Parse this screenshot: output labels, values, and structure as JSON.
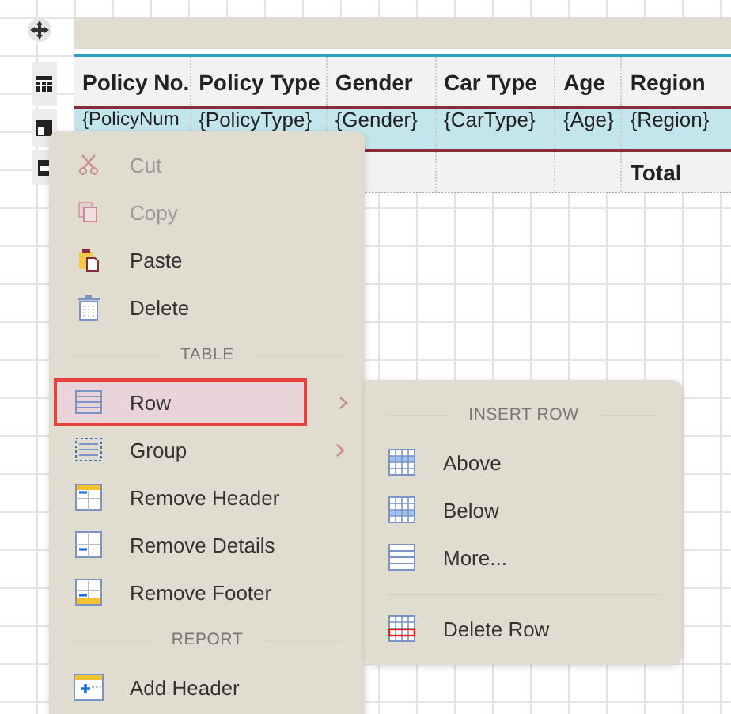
{
  "table": {
    "columns": [
      "Policy No.",
      "Policy Type",
      "Gender",
      "Car Type",
      "Age",
      "Region"
    ],
    "details_row": {
      "selected": true,
      "cells": [
        "{PolicyNum",
        "{PolicyType}",
        "{Gender}",
        "{CarType}",
        "{Age}",
        "{Region}"
      ]
    },
    "footer_total": "Total"
  },
  "context_menu": [
    {
      "kind": "item",
      "label": "Cut",
      "disabled": true
    },
    {
      "kind": "item",
      "label": "Copy",
      "disabled": true
    },
    {
      "kind": "item",
      "label": "Paste",
      "disabled": false
    },
    {
      "kind": "item",
      "label": "Delete",
      "disabled": false
    },
    {
      "kind": "section",
      "label": "TABLE"
    },
    {
      "kind": "item",
      "label": "Row",
      "disabled": false,
      "selected": true,
      "submenu": true
    },
    {
      "kind": "item",
      "label": "Group",
      "disabled": false,
      "selected": false,
      "submenu": true
    },
    {
      "kind": "item",
      "label": "Remove Header",
      "disabled": false
    },
    {
      "kind": "item",
      "label": "Remove Details",
      "disabled": false
    },
    {
      "kind": "item",
      "label": "Remove Footer",
      "disabled": false
    },
    {
      "kind": "section",
      "label": "REPORT"
    },
    {
      "kind": "item",
      "label": "Add Header",
      "disabled": false
    }
  ],
  "submenu": [
    {
      "kind": "section",
      "label": "INSERT ROW"
    },
    {
      "kind": "item",
      "label": "Above"
    },
    {
      "kind": "item",
      "label": "Below"
    },
    {
      "kind": "item",
      "label": "More..."
    },
    {
      "kind": "divider"
    },
    {
      "kind": "item",
      "label": "Delete Row"
    }
  ]
}
